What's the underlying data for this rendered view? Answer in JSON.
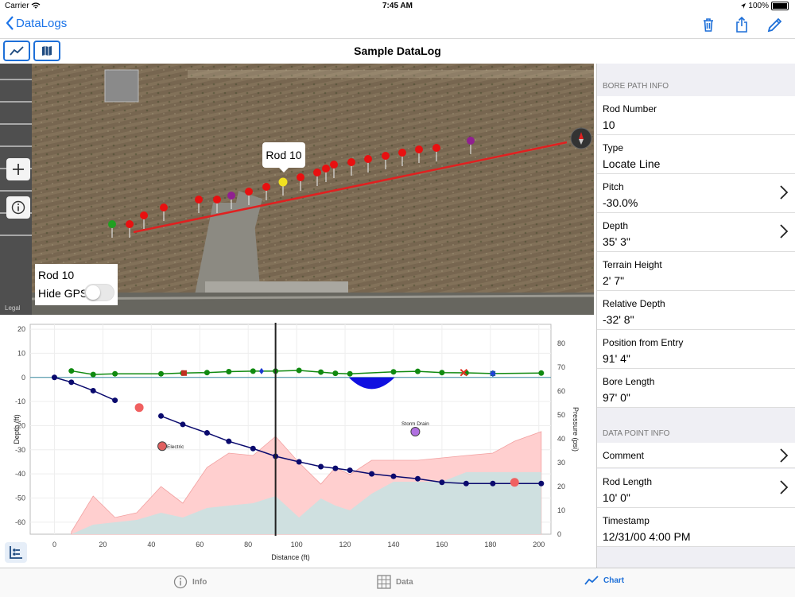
{
  "status": {
    "carrier": "Carrier",
    "time": "7:45 AM",
    "battery": "100%"
  },
  "nav": {
    "back_label": "DataLogs"
  },
  "toolbar": {
    "title": "Sample DataLog"
  },
  "map": {
    "callout": "Rod 10",
    "overlay_rod": "Rod 10",
    "hide_gps_label": "Hide GPS",
    "legal": "Legal"
  },
  "sidebar": {
    "bore_header": "BORE PATH INFO",
    "bore": [
      {
        "label": "Rod Number",
        "value": "10"
      },
      {
        "label": "Type",
        "value": "Locate Line"
      },
      {
        "label": "Pitch",
        "value": "-30.0%"
      },
      {
        "label": "Depth",
        "value": "35' 3\""
      },
      {
        "label": "Terrain Height",
        "value": "2' 7\""
      },
      {
        "label": "Relative Depth",
        "value": "-32' 8\""
      },
      {
        "label": "Position from Entry",
        "value": "91' 4\""
      },
      {
        "label": "Bore Length",
        "value": "97' 0\""
      }
    ],
    "dp_header": "DATA POINT INFO",
    "dp": [
      {
        "label": "Comment",
        "value": ""
      },
      {
        "label": "Rod Length",
        "value": "10' 0\""
      },
      {
        "label": "Timestamp",
        "value": "12/31/00 4:00 PM"
      }
    ]
  },
  "tabs": {
    "info": "Info",
    "data": "Data",
    "chart": "Chart"
  },
  "chart_data": {
    "type": "line",
    "xlabel": "Distance (ft)",
    "ylabel": "Depth (ft)",
    "y2label": "Pressure (psi)",
    "xlim": [
      -10,
      205
    ],
    "ylim": [
      -65,
      22
    ],
    "y2lim": [
      0,
      88
    ],
    "xticks": [
      0,
      20,
      40,
      60,
      80,
      100,
      120,
      140,
      160,
      180,
      200
    ],
    "yticks": [
      20,
      10,
      0,
      -10,
      -20,
      -30,
      -40,
      -50,
      -60
    ],
    "y2ticks": [
      80,
      70,
      60,
      50,
      40,
      30,
      20,
      10,
      0
    ],
    "cursor_x": 91.3,
    "depth_series": {
      "name": "Depth",
      "color": "#0a0a6e",
      "segments": [
        [
          [
            0,
            0
          ],
          [
            7,
            -2
          ],
          [
            16,
            -5.5
          ],
          [
            25,
            -9.5
          ]
        ],
        [
          [
            44,
            -16
          ],
          [
            53,
            -19.5
          ],
          [
            63,
            -23
          ],
          [
            72,
            -26.5
          ],
          [
            82,
            -29.5
          ],
          [
            91.3,
            -32.7
          ],
          [
            101,
            -35
          ],
          [
            110,
            -37
          ],
          [
            116,
            -37.7
          ],
          [
            122,
            -38.5
          ],
          [
            131,
            -40
          ],
          [
            140,
            -41
          ],
          [
            150,
            -42
          ],
          [
            160,
            -43.5
          ],
          [
            170,
            -44
          ],
          [
            181,
            -44
          ],
          [
            201,
            -44
          ]
        ]
      ]
    },
    "terrain_series": {
      "name": "Terrain Height",
      "color": "#108a10",
      "points": [
        [
          7,
          2.7
        ],
        [
          16,
          1.2
        ],
        [
          25,
          1.5
        ],
        [
          44,
          1.5
        ],
        [
          53,
          1.8
        ],
        [
          63,
          2
        ],
        [
          72,
          2.4
        ],
        [
          82,
          2.6
        ],
        [
          91.3,
          2.6
        ],
        [
          101,
          2.9
        ],
        [
          110,
          2.2
        ],
        [
          116,
          1.7
        ],
        [
          122,
          1.5
        ],
        [
          140,
          2.3
        ],
        [
          150,
          2.5
        ],
        [
          160,
          2.0
        ],
        [
          170,
          1.9
        ],
        [
          181,
          1.6
        ],
        [
          201,
          1.8
        ]
      ]
    },
    "markers": [
      {
        "x": 53.5,
        "y": 1.8,
        "shape": "square",
        "color": "#c03020"
      },
      {
        "x": 85.5,
        "y": 2.6,
        "shape": "diamond",
        "color": "#1a3ad0"
      },
      {
        "x": 169,
        "y": 2.0,
        "shape": "x",
        "color": "#e03020"
      },
      {
        "x": 181,
        "y": 1.6,
        "shape": "star",
        "color": "#2040e0"
      }
    ],
    "utilities": [
      {
        "x": 131,
        "width": 19,
        "depth": 4,
        "color": "#1010e0"
      }
    ],
    "pressure_upper": {
      "color": "#ffcfcf",
      "points": [
        [
          7,
          1
        ],
        [
          16,
          16
        ],
        [
          25,
          7
        ],
        [
          34,
          9
        ],
        [
          44,
          20
        ],
        [
          53,
          13
        ],
        [
          63,
          28
        ],
        [
          72,
          34
        ],
        [
          82,
          33
        ],
        [
          91.3,
          41
        ],
        [
          101,
          30
        ],
        [
          110,
          21
        ],
        [
          116,
          28
        ],
        [
          122,
          25
        ],
        [
          131,
          31
        ],
        [
          140,
          31
        ],
        [
          150,
          31
        ],
        [
          160,
          32
        ],
        [
          170,
          33
        ],
        [
          181,
          34
        ],
        [
          190,
          39
        ],
        [
          201,
          43
        ]
      ]
    },
    "pressure_lower": {
      "color": "#cfe0e0",
      "points": [
        [
          7,
          0
        ],
        [
          16,
          4
        ],
        [
          25,
          5
        ],
        [
          34,
          6
        ],
        [
          44,
          9
        ],
        [
          53,
          7
        ],
        [
          63,
          11
        ],
        [
          72,
          12
        ],
        [
          82,
          13
        ],
        [
          91.3,
          16
        ],
        [
          101,
          7
        ],
        [
          110,
          15
        ],
        [
          116,
          12
        ],
        [
          122,
          10
        ],
        [
          131,
          17
        ],
        [
          140,
          22
        ],
        [
          150,
          22
        ],
        [
          160,
          22
        ],
        [
          170,
          26
        ],
        [
          181,
          26
        ],
        [
          190,
          26
        ],
        [
          201,
          26
        ]
      ]
    },
    "events": [
      {
        "x": 35,
        "y": -12.5,
        "label": "",
        "color": "#f06060",
        "outline": false
      },
      {
        "x": 44.5,
        "y": -28.5,
        "label": "Electric",
        "color": "#e06060",
        "outline": true
      },
      {
        "x": 149,
        "y": -22.5,
        "label": "Storm Drain",
        "color": "#b070e0",
        "outline": true
      },
      {
        "x": 190,
        "y": -43.5,
        "label": "",
        "color": "#f06060",
        "outline": false
      }
    ]
  }
}
